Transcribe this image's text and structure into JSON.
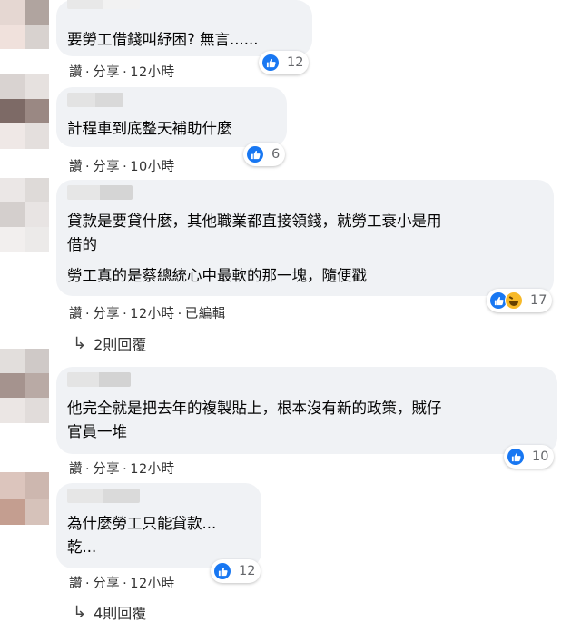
{
  "comments": [
    {
      "text_lines": [
        "要勞工借錢叫紓困? 無言......"
      ],
      "actions": [
        "讚",
        "分享"
      ],
      "time": "12小時",
      "reaction_count": "12",
      "reactions": [
        "like"
      ]
    },
    {
      "text_lines": [
        "計程車到底整天補助什麼"
      ],
      "actions": [
        "讚",
        "分享"
      ],
      "time": "10小時",
      "reaction_count": "6",
      "reactions": [
        "like"
      ]
    },
    {
      "text_lines": [
        "貸款是要貸什麼，其他職業都直接領錢，就勞工衰小是用",
        "借的",
        "勞工真的是蔡總統心中最軟的那一塊，隨便戳"
      ],
      "actions": [
        "讚",
        "分享"
      ],
      "time": "12小時",
      "edited": "已編輯",
      "reaction_count": "17",
      "reactions": [
        "like",
        "haha"
      ],
      "replies": "2則回覆"
    },
    {
      "text_lines": [
        "他完全就是把去年的複製貼上，根本沒有新的政策，賊仔",
        "官員一堆"
      ],
      "actions": [
        "讚",
        "分享"
      ],
      "time": "12小時",
      "reaction_count": "10",
      "reactions": [
        "like"
      ]
    },
    {
      "text_lines": [
        "為什麼勞工只能貸款...",
        "乾..."
      ],
      "actions": [
        "讚",
        "分享"
      ],
      "time": "12小時",
      "reaction_count": "12",
      "reactions": [
        "like"
      ],
      "replies": "4則回覆"
    }
  ],
  "separator": "·",
  "reply_arrow": "↳",
  "colors": {
    "bubble": "#f0f2f5",
    "like": "#1877f2",
    "haha": "#f7b928",
    "meta": "#333333"
  }
}
